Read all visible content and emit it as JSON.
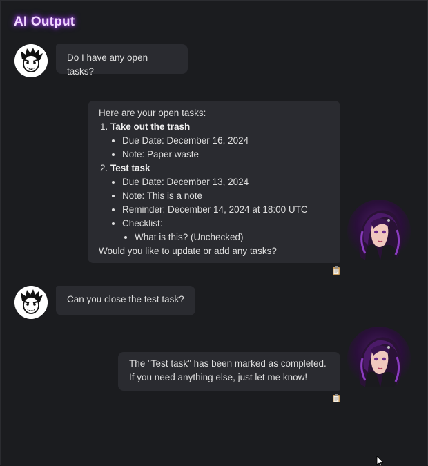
{
  "title": "AI Output",
  "messages": [
    {
      "role": "user",
      "text": "Do I have any open tasks?"
    },
    {
      "role": "ai",
      "intro": "Here are your open tasks:",
      "tasks": [
        {
          "name": "Take out the trash",
          "details": [
            "Due Date: December 16, 2024",
            "Note: Paper waste"
          ]
        },
        {
          "name": "Test task",
          "details": [
            "Due Date: December 13, 2024",
            "Note: This is a note",
            "Reminder: December 14, 2024 at 18:00 UTC",
            "Checklist:"
          ],
          "checklist": [
            "What is this? (Unchecked)"
          ]
        }
      ],
      "outro": "Would you like to update or add any tasks?"
    },
    {
      "role": "user",
      "text": "Can you close the test task?"
    },
    {
      "role": "ai",
      "lines": [
        "The \"Test task\" has been marked as completed.",
        "If you need anything else, just let me know!"
      ]
    }
  ],
  "icons": {
    "user_avatar": "cartoon-face-icon",
    "ai_avatar": "anime-girl-avatar",
    "copy": "clipboard-icon"
  },
  "colors": {
    "background": "#1b1c1f",
    "bubble": "#2a2b30",
    "title_glow": "#b044ff"
  }
}
